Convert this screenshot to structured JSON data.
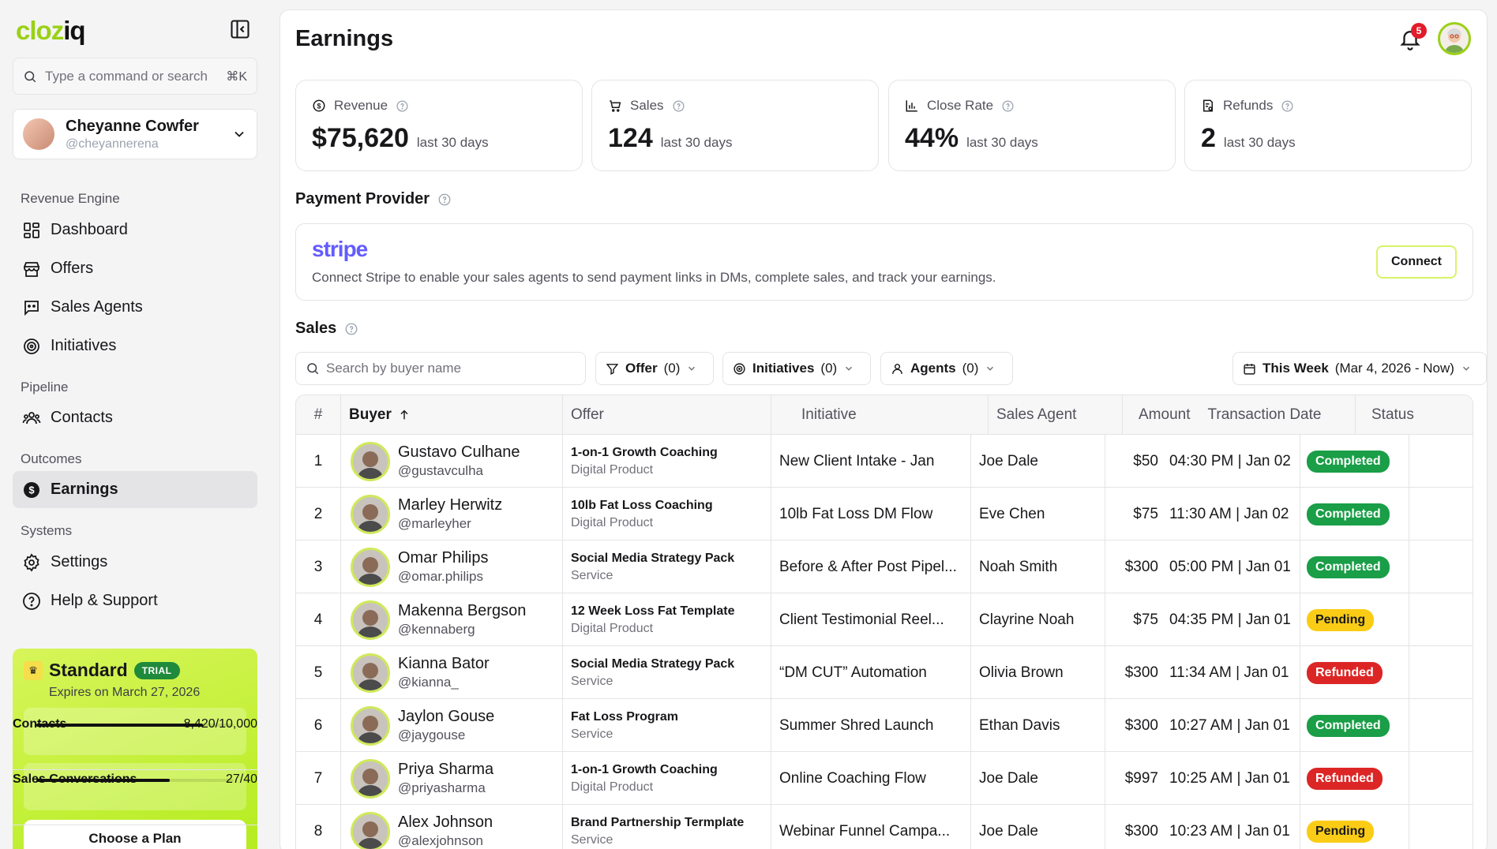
{
  "brand": {
    "logo_prefix": "clo",
    "logo_mid": "z",
    "logo_suffix": "iq"
  },
  "search": {
    "placeholder": "Type a command or search",
    "shortcut": "⌘K"
  },
  "profile": {
    "name": "Cheyanne Cowfer",
    "handle": "@cheyannerena"
  },
  "sections": {
    "revenue_engine": "Revenue Engine",
    "pipeline": "Pipeline",
    "outcomes": "Outcomes",
    "systems": "Systems"
  },
  "nav": {
    "dashboard": "Dashboard",
    "offers": "Offers",
    "sales_agents": "Sales Agents",
    "initiatives": "Initiatives",
    "contacts": "Contacts",
    "earnings": "Earnings",
    "settings": "Settings",
    "help": "Help & Support"
  },
  "plan": {
    "name": "Standard",
    "badge": "TRIAL",
    "expires": "Expires on March 27, 2026",
    "contacts_label": "Contacts",
    "contacts_value": "8,420/10,000",
    "contacts_fraction": 0.842,
    "convos_label": "Sales Conversations",
    "convos_value": "27/40",
    "convos_fraction": 0.675,
    "cta": "Choose a Plan"
  },
  "header": {
    "title": "Earnings",
    "notifications": "5"
  },
  "stats": [
    {
      "label": "Revenue",
      "value": "$75,620",
      "period": "last 30 days",
      "icon": "dollar-circle-icon"
    },
    {
      "label": "Sales",
      "value": "124",
      "period": "last 30 days",
      "icon": "cart-icon"
    },
    {
      "label": "Close Rate",
      "value": "44%",
      "period": "last 30 days",
      "icon": "bar-chart-icon"
    },
    {
      "label": "Refunds",
      "value": "2",
      "period": "last 30 days",
      "icon": "receipt-icon"
    }
  ],
  "payment": {
    "title": "Payment Provider",
    "provider": "stripe",
    "description": "Connect Stripe to enable your sales agents to send payment links in DMs, complete sales, and track your earnings.",
    "connect": "Connect"
  },
  "sales": {
    "title": "Sales",
    "search_placeholder": "Search by buyer name",
    "filters": {
      "offer": "Offer",
      "offer_count": "(0)",
      "initiatives": "Initiatives",
      "initiatives_count": "(0)",
      "agents": "Agents",
      "agents_count": "(0)",
      "date": "This Week",
      "date_range": "(Mar 4, 2026 - Now)"
    },
    "columns": {
      "num": "#",
      "buyer": "Buyer",
      "offer": "Offer",
      "initiative": "Initiative",
      "agent": "Sales Agent",
      "amount": "Amount",
      "date": "Transaction Date",
      "status": "Status"
    },
    "rows": [
      {
        "n": "1",
        "name": "Gustavo Culhane",
        "handle": "@gustavculha",
        "offer": "1-on-1 Growth Coaching",
        "offer_type": "Digital Product",
        "initiative": "New Client Intake - Jan",
        "agent": "Joe Dale",
        "amount": "$50",
        "date": "04:30 PM | Jan 02",
        "status": "Completed",
        "status_key": "completed"
      },
      {
        "n": "2",
        "name": "Marley Herwitz",
        "handle": "@marleyher",
        "offer": "10lb Fat Loss Coaching",
        "offer_type": "Digital Product",
        "initiative": "10lb Fat Loss DM Flow",
        "agent": "Eve Chen",
        "amount": "$75",
        "date": "11:30 AM | Jan 02",
        "status": "Completed",
        "status_key": "completed"
      },
      {
        "n": "3",
        "name": "Omar Philips",
        "handle": "@omar.philips",
        "offer": "Social Media Strategy Pack",
        "offer_type": "Service",
        "initiative": "Before & After Post Pipel...",
        "agent": "Noah Smith",
        "amount": "$300",
        "date": "05:00 PM | Jan 01",
        "status": "Completed",
        "status_key": "completed"
      },
      {
        "n": "4",
        "name": "Makenna Bergson",
        "handle": "@kennaberg",
        "offer": "12 Week Loss Fat Template",
        "offer_type": "Digital Product",
        "initiative": "Client Testimonial Reel...",
        "agent": "Clayrine Noah",
        "amount": "$75",
        "date": "04:35 PM | Jan 01",
        "status": "Pending",
        "status_key": "pending"
      },
      {
        "n": "5",
        "name": "Kianna Bator",
        "handle": "@kianna_",
        "offer": "Social Media Strategy Pack",
        "offer_type": "Service",
        "initiative": "“DM CUT” Automation",
        "agent": "Olivia Brown",
        "amount": "$300",
        "date": "11:34 AM | Jan 01",
        "status": "Refunded",
        "status_key": "refunded"
      },
      {
        "n": "6",
        "name": "Jaylon Gouse",
        "handle": "@jaygouse",
        "offer": "Fat Loss Program",
        "offer_type": "Service",
        "initiative": "Summer Shred Launch",
        "agent": "Ethan Davis",
        "amount": "$300",
        "date": "10:27 AM | Jan 01",
        "status": "Completed",
        "status_key": "completed"
      },
      {
        "n": "7",
        "name": "Priya Sharma",
        "handle": "@priyasharma",
        "offer": "1-on-1 Growth Coaching",
        "offer_type": "Digital Product",
        "initiative": "Online Coaching Flow",
        "agent": "Joe Dale",
        "amount": "$997",
        "date": "10:25 AM | Jan 01",
        "status": "Refunded",
        "status_key": "refunded"
      },
      {
        "n": "8",
        "name": "Alex Johnson",
        "handle": "@alexjohnson",
        "offer": "Brand Partnership Termplate",
        "offer_type": "Service",
        "initiative": "Webinar Funnel Campa...",
        "agent": "Joe Dale",
        "amount": "$300",
        "date": "10:23 AM | Jan 01",
        "status": "Pending",
        "status_key": "pending"
      }
    ]
  }
}
